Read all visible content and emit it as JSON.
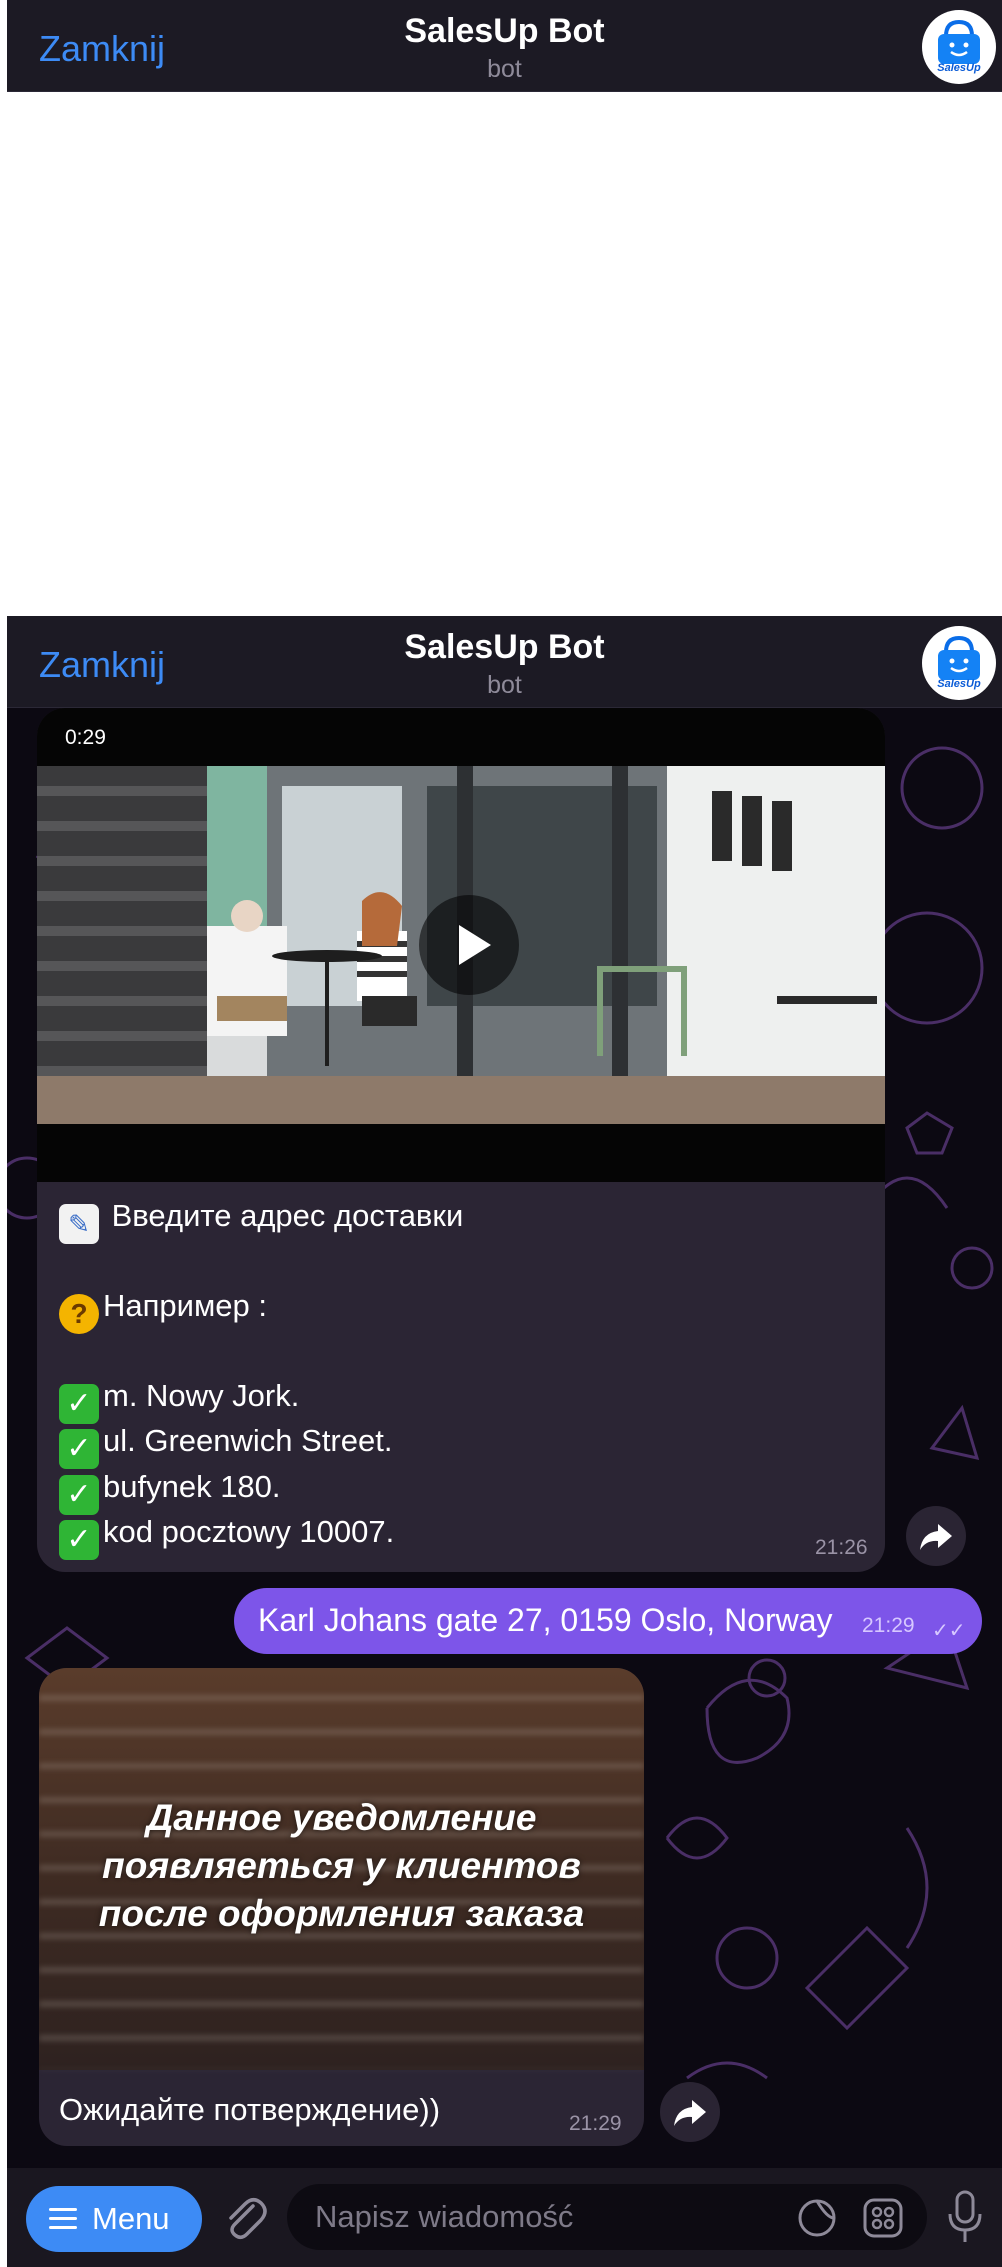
{
  "header_top": {
    "close_label": "Zamknij",
    "title": "SalesUp Bot",
    "subtitle": "bot",
    "avatar_label": "SalesUp"
  },
  "header_second": {
    "close_label": "Zamknij",
    "title": "SalesUp Bot",
    "subtitle": "bot",
    "avatar_label": "SalesUp"
  },
  "colors": {
    "accent": "#3d8bf5",
    "outgoing_bubble": "#7d55e9",
    "incoming_bubble": "#2b2534",
    "chat_background": "#0c0912"
  },
  "messages": {
    "video_message": {
      "duration": "0:29",
      "line_address": "Введите адрес доставки",
      "line_example": "Например :",
      "lines": [
        "m. Nowy Jork.",
        "ul. Greenwich Street.",
        "bufynek 180.",
        "kod pocztowy 10007."
      ],
      "time": "21:26",
      "icons": {
        "memo": "memo-emoji",
        "thinking": "thinking-face-emoji",
        "check": "check-mark-emoji"
      }
    },
    "outgoing": {
      "text": "Karl Johans gate 27, 0159 Oslo, Norway",
      "time": "21:29",
      "status_icon": "double-check-icon"
    },
    "image_message": {
      "caption_lines": [
        "Данное уведомление",
        "появляеться у клиентов",
        "после оформления заказа"
      ],
      "text": "Ожидайте потверждение))",
      "time": "21:29"
    }
  },
  "bottom_bar": {
    "menu_label": "Menu",
    "input_placeholder": "Napisz wiadomość"
  }
}
